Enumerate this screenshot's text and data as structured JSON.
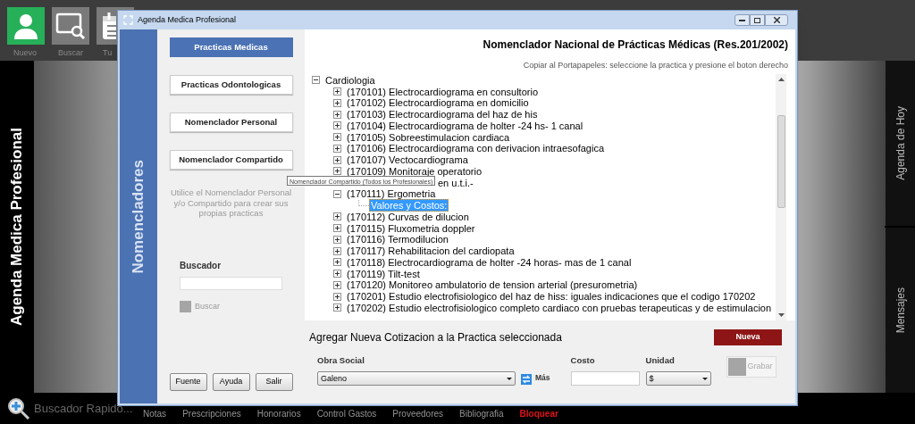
{
  "app": {
    "toolbar": [
      {
        "label": "Nuevo",
        "kind": "new"
      },
      {
        "label": "Buscar",
        "kind": "search"
      },
      {
        "label": "Tu",
        "kind": "calendar"
      }
    ],
    "side_title": "Agenda Medica Profesional",
    "right_tabs": [
      "Agenda de Hoy",
      "Mensajes"
    ],
    "quick_search": {
      "placeholder": "Buscador Rapido..."
    },
    "bottom_links": [
      {
        "label": "Notas",
        "kind": "link"
      },
      {
        "label": "Prescripciones",
        "kind": "link"
      },
      {
        "label": "Honorarios",
        "kind": "link"
      },
      {
        "label": "Control Gastos",
        "kind": "link"
      },
      {
        "label": "Proveedores",
        "kind": "link"
      },
      {
        "label": "Bibliografia",
        "kind": "link"
      },
      {
        "label": "Bloquear",
        "kind": "alert"
      }
    ]
  },
  "window": {
    "title": "Agenda Medica Profesional",
    "side_label": "Nomencladores",
    "nav_buttons": [
      {
        "label": "Practicas Medicas",
        "selected": true
      },
      {
        "label": "Practicas Odontologicas",
        "selected": false
      },
      {
        "label": "Nomenclador Personal",
        "selected": false
      },
      {
        "label": "Nomenclador Compartido",
        "selected": false
      }
    ],
    "hint": "Utilice el Nomenclador Personal y/o Compartido para crear sus propias practicas",
    "search": {
      "label": "Buscador",
      "button": "Buscar",
      "disabled": true
    },
    "footer_buttons": [
      "Fuente",
      "Ayuda",
      "Salir"
    ],
    "heading": "Nomenclador Nacional de Prácticas Médicas (Res.201/2002)",
    "subheading": "Copiar al Portapapeles: seleccione la practica y presione el boton derecho",
    "tree": [
      {
        "label": "Cardiologia",
        "kind": "item",
        "expanded": true,
        "selected": false,
        "children": [
          {
            "label": "(170101) Electrocardiograma en consultorio",
            "kind": "item",
            "expanded": false,
            "selected": false
          },
          {
            "label": "(170102) Electrocardiograma en domicilio",
            "kind": "item",
            "expanded": false,
            "selected": false
          },
          {
            "label": "(170103) Electrocardiograma del haz de his",
            "kind": "item",
            "expanded": false,
            "selected": false
          },
          {
            "label": "(170104) Electrocardiograma de holter -24 hs- 1 canal",
            "kind": "item",
            "expanded": false,
            "selected": false
          },
          {
            "label": "(170105) Sobreestimulacion cardiaca",
            "kind": "item",
            "expanded": false,
            "selected": false
          },
          {
            "label": "(170106) Electrocardiograma con derivacion intraesofagica",
            "kind": "item",
            "expanded": false,
            "selected": false
          },
          {
            "label": "(170107) Vectocardiograma",
            "kind": "item",
            "expanded": false,
            "selected": false
          },
          {
            "label": "(170109) Monitoraje operatorio",
            "kind": "item",
            "expanded": false,
            "selected": false
          },
          {
            "label": "en u.t.i.-",
            "kind": "covered",
            "selected": false
          },
          {
            "label": "(170111) Ergometria",
            "kind": "item",
            "expanded": true,
            "selected": false,
            "children": [
              {
                "label": "Valores y Costos:",
                "kind": "leaf",
                "selected": true
              }
            ]
          },
          {
            "label": "(170112) Curvas de dilucion",
            "kind": "item",
            "expanded": false,
            "selected": false
          },
          {
            "label": "(170115) Fluxometria doppler",
            "kind": "item",
            "expanded": false,
            "selected": false
          },
          {
            "label": "(170116) Termodilucion",
            "kind": "item",
            "expanded": false,
            "selected": false
          },
          {
            "label": "(170117) Rehabilitacion del cardiopata",
            "kind": "item",
            "expanded": false,
            "selected": false
          },
          {
            "label": "(170118) Electrocardiograma de holter -24 horas- mas de 1 canal",
            "kind": "item",
            "expanded": false,
            "selected": false
          },
          {
            "label": "(170119) Tilt-test",
            "kind": "item",
            "expanded": false,
            "selected": false
          },
          {
            "label": "(170120) Monitoreo ambulatorio de tension arterial (presurometria)",
            "kind": "item",
            "expanded": false,
            "selected": false
          },
          {
            "label": "(170201) Estudio electrofisiologico del haz de hiss: iguales indicaciones que el codigo 170202",
            "kind": "item",
            "expanded": false,
            "selected": false
          },
          {
            "label": "(170202) Estudio electrofisiologico completo cardiaco con pruebas terapeuticas y de estimulacion",
            "kind": "item",
            "expanded": false,
            "selected": false
          }
        ]
      }
    ],
    "tooltip": "Nomenclador Compartido (Todos los Profesionales)",
    "form": {
      "title": "Agregar Nueva Cotizacion a la Practica seleccionada",
      "new_button": "Nueva",
      "obra_social": {
        "label": "Obra Social",
        "value": "Galeno"
      },
      "more": "Más",
      "cost": {
        "label": "Costo"
      },
      "unit": {
        "label": "Unidad",
        "value": "$"
      },
      "save_button": {
        "label": "Grabar",
        "disabled": true
      }
    }
  }
}
